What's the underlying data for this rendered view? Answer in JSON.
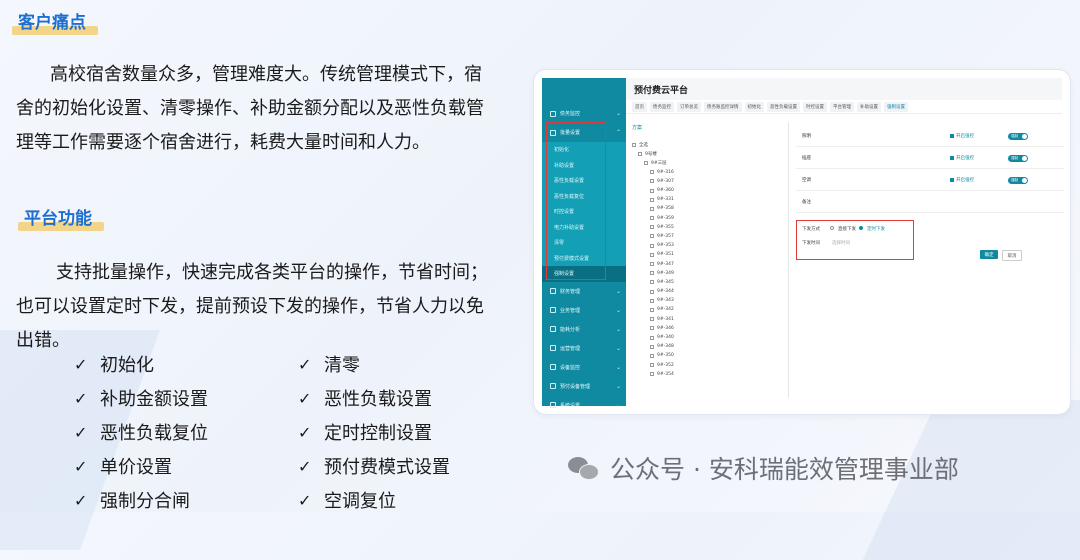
{
  "sections": {
    "pain_title": "客户痛点",
    "pain_lines": [
      "高校宿舍数量众多，管理难度大。传统管理模式下，宿",
      "舍的初始化设置、清零操作、补助金额分配以及恶性负载管",
      "理等工作需要逐个宿舍进行，耗费大量时间和人力。"
    ],
    "func_title": "平台功能",
    "func_lines": [
      "支持批量操作，快速完成各类平台的操作，节省时间；",
      "也可以设置定时下发，提前预设下发的操作，节省人力以免",
      "出错。"
    ],
    "check_mark": "✓",
    "features_left": [
      "初始化",
      "补助金额设置",
      "恶性负载复位",
      "单价设置",
      "强制分合闸"
    ],
    "features_right": [
      "清零",
      "恶性负载设置",
      "定时控制设置",
      "预付费模式设置",
      "空调复位"
    ]
  },
  "app": {
    "title": "预付费云平台",
    "sidebar": {
      "items_top": [
        "债务监控",
        "批量设置"
      ],
      "sub_items": [
        "初始化",
        "补助设置",
        "恶性负载设置",
        "恶性负载复位",
        "时控设置",
        "电力补助设置",
        "清零",
        "预付费模式设置",
        "强制设置"
      ],
      "items_bottom": [
        "财务管理",
        "业务管理",
        "能耗分析",
        "运营管理",
        "设备监控",
        "预付设备管理",
        "系统设置"
      ]
    },
    "tabs": [
      "首页",
      "债务监控",
      "订单总览",
      "债务账监控详情",
      "初始化",
      "恶性负载设置",
      "时控设置",
      "平台管理",
      "补助设置",
      "强制设置"
    ],
    "tree_header": "方案",
    "tree": {
      "all": "全选",
      "building": "9号楼",
      "floor": "9#三层",
      "rooms": [
        "9#-316",
        "9#-307",
        "9#-360",
        "9#-331",
        "9#-358",
        "9#-359",
        "9#-355",
        "9#-357",
        "9#-353",
        "9#-351",
        "9#-347",
        "9#-349",
        "9#-345",
        "9#-344",
        "9#-343",
        "9#-342",
        "9#-341",
        "9#-346",
        "9#-340",
        "9#-348",
        "9#-350",
        "9#-352",
        "9#-354"
      ]
    },
    "modes": [
      {
        "label": "照明",
        "check": "开启强控",
        "toggle": "强制"
      },
      {
        "label": "插座",
        "check": "开启强控",
        "toggle": "强制"
      },
      {
        "label": "空调",
        "check": "开启强控",
        "toggle": "强制"
      }
    ],
    "remark_label": "备注",
    "send_method_label": "下发方式",
    "send_options": [
      "直接下发",
      "定时下发"
    ],
    "send_time_label": "下发时间",
    "send_time_placeholder": "选择时间",
    "confirm_button": "确定",
    "cancel_button": "取消"
  },
  "watermark": "公众号 · 安科瑞能效管理事业部"
}
